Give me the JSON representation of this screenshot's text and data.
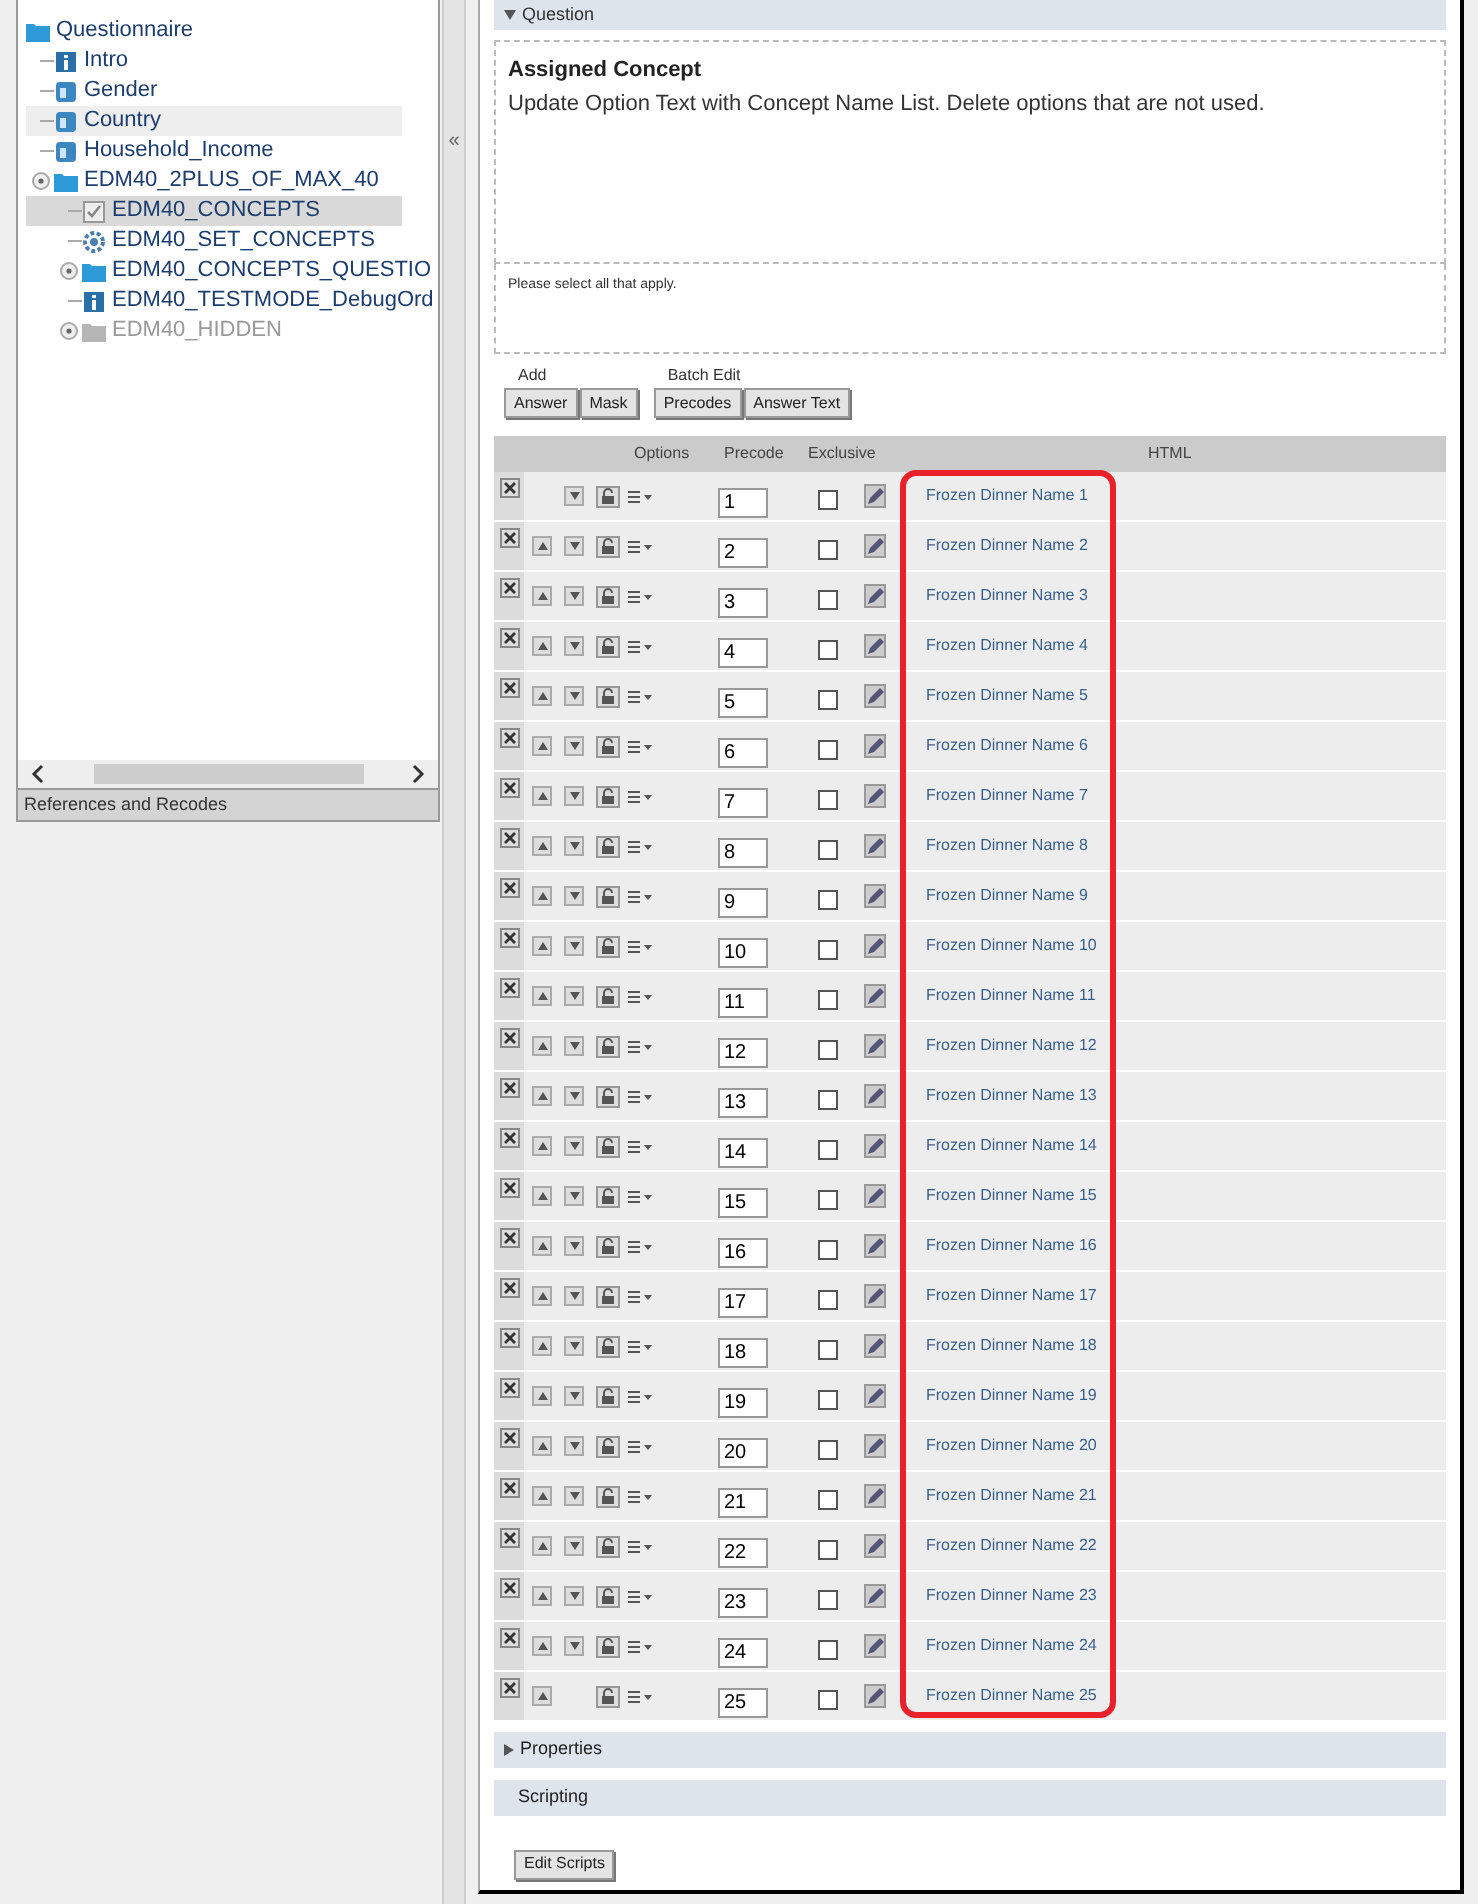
{
  "tree": {
    "label": "Questionnaire",
    "kind": "folder",
    "children": [
      {
        "label": "Intro",
        "kind": "info",
        "selected": false,
        "hovered": false,
        "disabled": false,
        "expandable": false
      },
      {
        "label": "Gender",
        "kind": "question",
        "selected": false,
        "hovered": false,
        "disabled": false,
        "expandable": false
      },
      {
        "label": "Country",
        "kind": "question",
        "selected": false,
        "hovered": true,
        "disabled": false,
        "expandable": false
      },
      {
        "label": "Household_Income",
        "kind": "question",
        "selected": false,
        "hovered": false,
        "disabled": false,
        "expandable": false
      },
      {
        "label": "EDM40_2PLUS_OF_MAX_40",
        "kind": "folder",
        "selected": false,
        "hovered": false,
        "disabled": false,
        "expandable": true,
        "children": [
          {
            "label": "EDM40_CONCEPTS",
            "kind": "checkbox",
            "selected": true,
            "hovered": false,
            "disabled": false,
            "expandable": false
          },
          {
            "label": "EDM40_SET_CONCEPTS",
            "kind": "gear",
            "selected": false,
            "hovered": false,
            "disabled": false,
            "expandable": false
          },
          {
            "label": "EDM40_CONCEPTS_QUESTIO",
            "kind": "folder",
            "selected": false,
            "hovered": false,
            "disabled": false,
            "expandable": true
          },
          {
            "label": "EDM40_TESTMODE_DebugOrd",
            "kind": "info",
            "selected": false,
            "hovered": false,
            "disabled": false,
            "expandable": false
          },
          {
            "label": "EDM40_HIDDEN",
            "kind": "folder",
            "selected": false,
            "hovered": false,
            "disabled": true,
            "expandable": true
          }
        ]
      }
    ]
  },
  "references_panel": {
    "title": "References and Recodes"
  },
  "splitter": {
    "glyph": "«"
  },
  "question_section": {
    "title": "Question",
    "expanded": true
  },
  "question_text": {
    "title": "Assigned Concept",
    "body": "Update Option Text with Concept Name List. Delete options that are not used."
  },
  "instruction_text": "Please select all that apply.",
  "toolbar": {
    "groups": [
      {
        "label": "Add",
        "buttons": [
          "Answer",
          "Mask"
        ]
      },
      {
        "label": "Batch Edit",
        "buttons": [
          "Precodes",
          "Answer Text"
        ]
      }
    ]
  },
  "table": {
    "columns": [
      "Options",
      "Precode",
      "Exclusive",
      "HTML"
    ],
    "html_column_highlighted": true,
    "rows": [
      {
        "precode": "1",
        "exclusive": false,
        "html": "Frozen Dinner Name 1",
        "can_move_up": false,
        "can_move_down": true
      },
      {
        "precode": "2",
        "exclusive": false,
        "html": "Frozen Dinner Name 2",
        "can_move_up": true,
        "can_move_down": true
      },
      {
        "precode": "3",
        "exclusive": false,
        "html": "Frozen Dinner Name 3",
        "can_move_up": true,
        "can_move_down": true
      },
      {
        "precode": "4",
        "exclusive": false,
        "html": "Frozen Dinner Name 4",
        "can_move_up": true,
        "can_move_down": true
      },
      {
        "precode": "5",
        "exclusive": false,
        "html": "Frozen Dinner Name 5",
        "can_move_up": true,
        "can_move_down": true
      },
      {
        "precode": "6",
        "exclusive": false,
        "html": "Frozen Dinner Name 6",
        "can_move_up": true,
        "can_move_down": true
      },
      {
        "precode": "7",
        "exclusive": false,
        "html": "Frozen Dinner Name 7",
        "can_move_up": true,
        "can_move_down": true
      },
      {
        "precode": "8",
        "exclusive": false,
        "html": "Frozen Dinner Name 8",
        "can_move_up": true,
        "can_move_down": true
      },
      {
        "precode": "9",
        "exclusive": false,
        "html": "Frozen Dinner Name 9",
        "can_move_up": true,
        "can_move_down": true
      },
      {
        "precode": "10",
        "exclusive": false,
        "html": "Frozen Dinner Name 10",
        "can_move_up": true,
        "can_move_down": true
      },
      {
        "precode": "11",
        "exclusive": false,
        "html": "Frozen Dinner Name 11",
        "can_move_up": true,
        "can_move_down": true
      },
      {
        "precode": "12",
        "exclusive": false,
        "html": "Frozen Dinner Name 12",
        "can_move_up": true,
        "can_move_down": true
      },
      {
        "precode": "13",
        "exclusive": false,
        "html": "Frozen Dinner Name 13",
        "can_move_up": true,
        "can_move_down": true
      },
      {
        "precode": "14",
        "exclusive": false,
        "html": "Frozen Dinner Name 14",
        "can_move_up": true,
        "can_move_down": true
      },
      {
        "precode": "15",
        "exclusive": false,
        "html": "Frozen Dinner Name 15",
        "can_move_up": true,
        "can_move_down": true
      },
      {
        "precode": "16",
        "exclusive": false,
        "html": "Frozen Dinner Name 16",
        "can_move_up": true,
        "can_move_down": true
      },
      {
        "precode": "17",
        "exclusive": false,
        "html": "Frozen Dinner Name 17",
        "can_move_up": true,
        "can_move_down": true
      },
      {
        "precode": "18",
        "exclusive": false,
        "html": "Frozen Dinner Name 18",
        "can_move_up": true,
        "can_move_down": true
      },
      {
        "precode": "19",
        "exclusive": false,
        "html": "Frozen Dinner Name 19",
        "can_move_up": true,
        "can_move_down": true
      },
      {
        "precode": "20",
        "exclusive": false,
        "html": "Frozen Dinner Name 20",
        "can_move_up": true,
        "can_move_down": true
      },
      {
        "precode": "21",
        "exclusive": false,
        "html": "Frozen Dinner Name 21",
        "can_move_up": true,
        "can_move_down": true
      },
      {
        "precode": "22",
        "exclusive": false,
        "html": "Frozen Dinner Name 22",
        "can_move_up": true,
        "can_move_down": true
      },
      {
        "precode": "23",
        "exclusive": false,
        "html": "Frozen Dinner Name 23",
        "can_move_up": true,
        "can_move_down": true
      },
      {
        "precode": "24",
        "exclusive": false,
        "html": "Frozen Dinner Name 24",
        "can_move_up": true,
        "can_move_down": true
      },
      {
        "precode": "25",
        "exclusive": false,
        "html": "Frozen Dinner Name 25",
        "can_move_up": true,
        "can_move_down": false
      }
    ]
  },
  "properties_section": {
    "title": "Properties",
    "expanded": false
  },
  "scripting_section": {
    "title": "Scripting"
  },
  "edit_scripts_button": "Edit Scripts"
}
